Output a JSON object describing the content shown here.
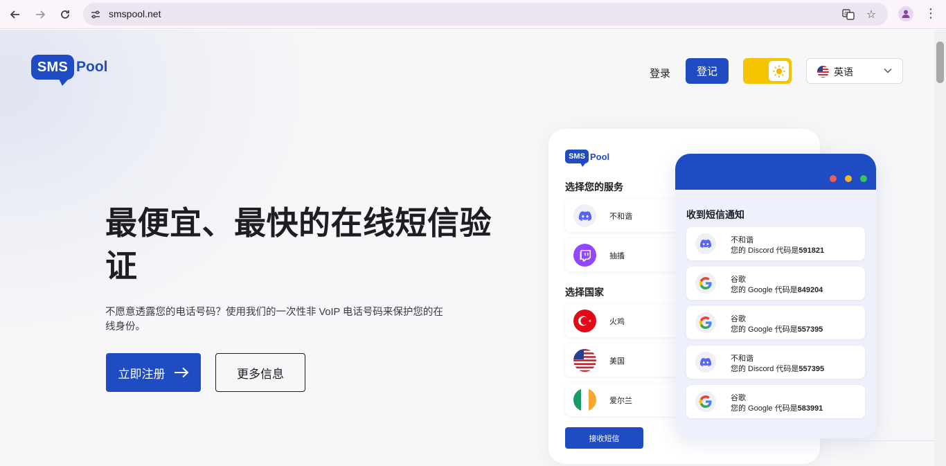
{
  "browser": {
    "url": "smspool.net"
  },
  "header": {
    "logo_sms": "SMS",
    "logo_pool": "Pool",
    "login_label": "登录",
    "register_label": "登记",
    "language_label": "英语"
  },
  "hero": {
    "title": "最便宜、最快的在线短信验证",
    "subtitle": "不愿意透露您的电话号码？使用我们的一次性非 VoIP 电话号码来保护您的在线身份。",
    "cta_primary": "立即注册",
    "cta_secondary": "更多信息"
  },
  "mock": {
    "logo_sms": "SMS",
    "logo_pool": "Pool",
    "services_heading": "选择您的服务",
    "services": [
      {
        "label": "不和谐",
        "icon": "discord-icon"
      },
      {
        "label": "抽搐",
        "icon": "twitch-icon"
      }
    ],
    "countries_heading": "选择国家",
    "countries": [
      {
        "label": "火鸡",
        "icon": "turkey-flag-icon"
      },
      {
        "label": "美国",
        "icon": "us-flag-icon"
      },
      {
        "label": "爱尔兰",
        "icon": "ireland-flag-icon"
      }
    ],
    "receive_button": "接收短信",
    "notifications_heading": "收到短信通知",
    "notifications": [
      {
        "name": "不和谐",
        "prefix": "您的 Discord 代码是",
        "code": "591821",
        "icon": "discord-icon"
      },
      {
        "name": "谷歌",
        "prefix": "您的 Google 代码是",
        "code": "849204",
        "icon": "google-icon"
      },
      {
        "name": "谷歌",
        "prefix": "您的 Google 代码是",
        "code": "557395",
        "icon": "google-icon"
      },
      {
        "name": "不和谐",
        "prefix": "您的 Discord 代码是",
        "code": "557395",
        "icon": "discord-icon"
      },
      {
        "name": "谷歌",
        "prefix": "您的 Google 代码是",
        "code": "583991",
        "icon": "google-icon"
      }
    ]
  },
  "colors": {
    "brand": "#1f4bc3",
    "toggle": "#f5c400",
    "discord": "#5865f2",
    "twitch": "#9146ff"
  }
}
